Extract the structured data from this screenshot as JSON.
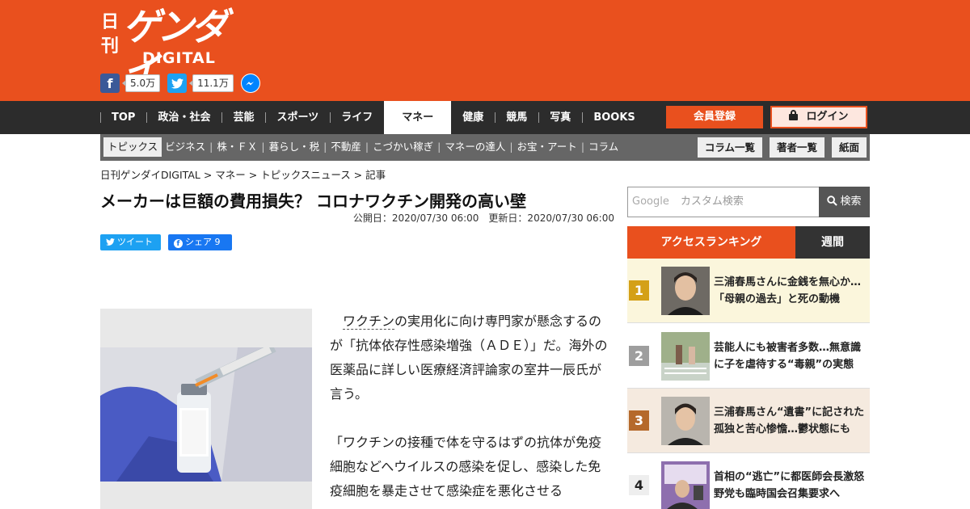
{
  "header": {
    "logo_nikkan": "日刊",
    "logo_gendai": "ゲンダイ",
    "logo_digital": "DIGITAL",
    "facebook_count": "5.0万",
    "twitter_count": "11.1万"
  },
  "nav": {
    "items": [
      "TOP",
      "政治・社会",
      "芸能",
      "スポーツ",
      "ライフ",
      "マネー",
      "健康",
      "競馬",
      "写真",
      "BOOKS"
    ],
    "active": "マネー",
    "register": "会員登録",
    "login": "ログイン"
  },
  "subnav": {
    "items": [
      "トピックス",
      "ビジネス",
      "株・ＦＸ",
      "暮らし・税",
      "不動産",
      "こづかい稼ぎ",
      "マネーの達人",
      "お宝・アート",
      "コラム"
    ],
    "separator": "|",
    "buttons": [
      "コラム一覧",
      "著者一覧",
      "紙面"
    ]
  },
  "article": {
    "breadcrumb": "日刊ゲンダイDIGITAL > マネー > トピックスニュース > 記事",
    "title": "メーカーは巨額の費用損失？ コロナワクチン開発の高い壁",
    "dates": "公開日：2020/07/30 06:00　更新日：2020/07/30 06:00",
    "tweet_label": "ツイート",
    "share_label": "シェア 9",
    "body_p1_kw": "ワクチン",
    "body_p1_rest": "の実用化に向け専門家が懸念するのが「抗体依存性感染増強（ＡＤＥ）」だ。海外の医薬品に詳しい医療経済評論家の室井一辰氏が言う。",
    "body_p2": "「ワクチンの接種で体を守るはずの抗体が免疫細胞などへウイルスの感染を促し、感染した免疫細胞を暴走させて感染症を悪化させる"
  },
  "sidebar": {
    "search_google": "Google",
    "search_placeholder": "カスタム検索",
    "search_button": "検索",
    "ranking_tab": "アクセスランキング",
    "weekly_tab": "週間",
    "ranking": [
      {
        "rank": "1",
        "line1": "三浦春馬さんに金銭を無心か…",
        "line2": "「母親の過去」と死の動機"
      },
      {
        "rank": "2",
        "line1": "芸能人にも被害者多数…無意識",
        "line2": "に子を虐待する“毒親”の実態"
      },
      {
        "rank": "3",
        "line1": "三浦春馬さん“遺書”に記された",
        "line2": "孤独と苦心惨憺…鬱状態にも"
      },
      {
        "rank": "4",
        "line1": "首相の“逃亡”に都医師会長激怒",
        "line2": "野党も臨時国会召集要求へ"
      }
    ],
    "rank_colors": [
      "#d4a017",
      "#9e9e9e",
      "#b5692b",
      "#eeeeee"
    ],
    "rank_bgs": [
      "#fbf6dc",
      "#ffffff",
      "#f5eadf",
      "#ffffff"
    ]
  }
}
